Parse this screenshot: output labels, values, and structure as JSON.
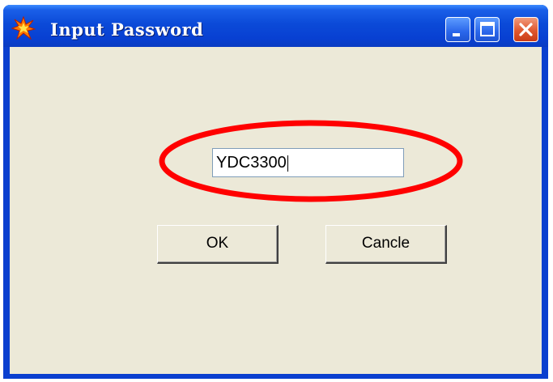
{
  "window": {
    "title": "Input Password",
    "icon": "burst-icon"
  },
  "controls": {
    "minimize_icon": "minimize-icon",
    "maximize_icon": "maximize-icon",
    "close_icon": "close-icon"
  },
  "form": {
    "password_value": "YDC3300",
    "ok_label": "OK",
    "cancel_label": "Cancle"
  },
  "annotation": {
    "highlight_color": "#ff0000"
  },
  "colors": {
    "titlebar": "#0a46d6",
    "client_bg": "#ece9d8",
    "close_button": "#e0582f"
  }
}
